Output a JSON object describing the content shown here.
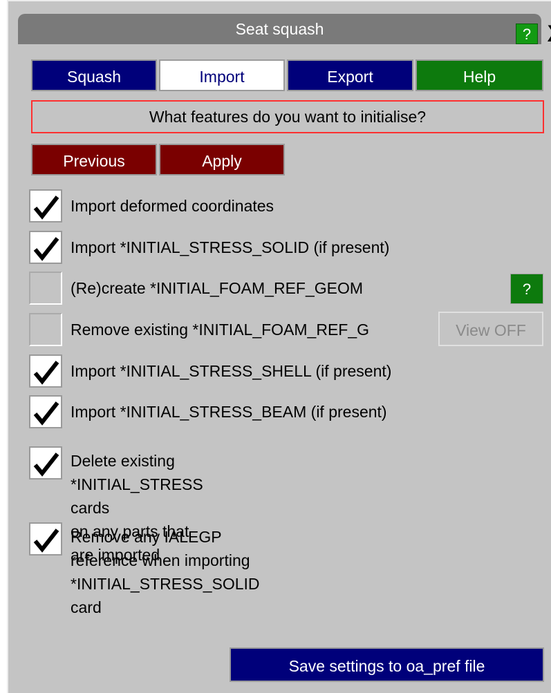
{
  "window": {
    "title": "Seat squash",
    "help_label": "?",
    "close_label": "X"
  },
  "tabs": [
    {
      "label": "Squash",
      "active": false
    },
    {
      "label": "Import",
      "active": true
    },
    {
      "label": "Export",
      "active": false
    },
    {
      "label": "Help",
      "active": false
    }
  ],
  "prompt": "What features do you want to initialise?",
  "actions": {
    "previous_label": "Previous",
    "apply_label": "Apply"
  },
  "options": [
    {
      "label": "Import deformed coordinates",
      "checked": true
    },
    {
      "label": "Import *INITIAL_STRESS_SOLID (if present)",
      "checked": true
    },
    {
      "label": "(Re)create *INITIAL_FOAM_REF_GEOM",
      "checked": false
    },
    {
      "label": "Remove existing *INITIAL_FOAM_REF_G",
      "checked": false,
      "disabled": true
    },
    {
      "label": "Import *INITIAL_STRESS_SHELL (if present)",
      "checked": true
    },
    {
      "label": "Import *INITIAL_STRESS_BEAM (if present)",
      "checked": true
    },
    {
      "label": "Delete existing *INITIAL_STRESS cards",
      "label2": "on any parts that are imported",
      "checked": true
    },
    {
      "label": "Remove any IALEGP reference when importing",
      "label2": "*INITIAL_STRESS_SOLID card",
      "checked": true
    }
  ],
  "foam_help_label": "?",
  "view_toggle_label": "View OFF",
  "save_label": "Save settings to oa_pref file",
  "colors": {
    "panel_bg": "#c4c4c4",
    "tab_blue": "#00007a",
    "tab_green": "#0d7a0d",
    "action_red": "#7a0000",
    "prompt_border": "#ff3030"
  }
}
